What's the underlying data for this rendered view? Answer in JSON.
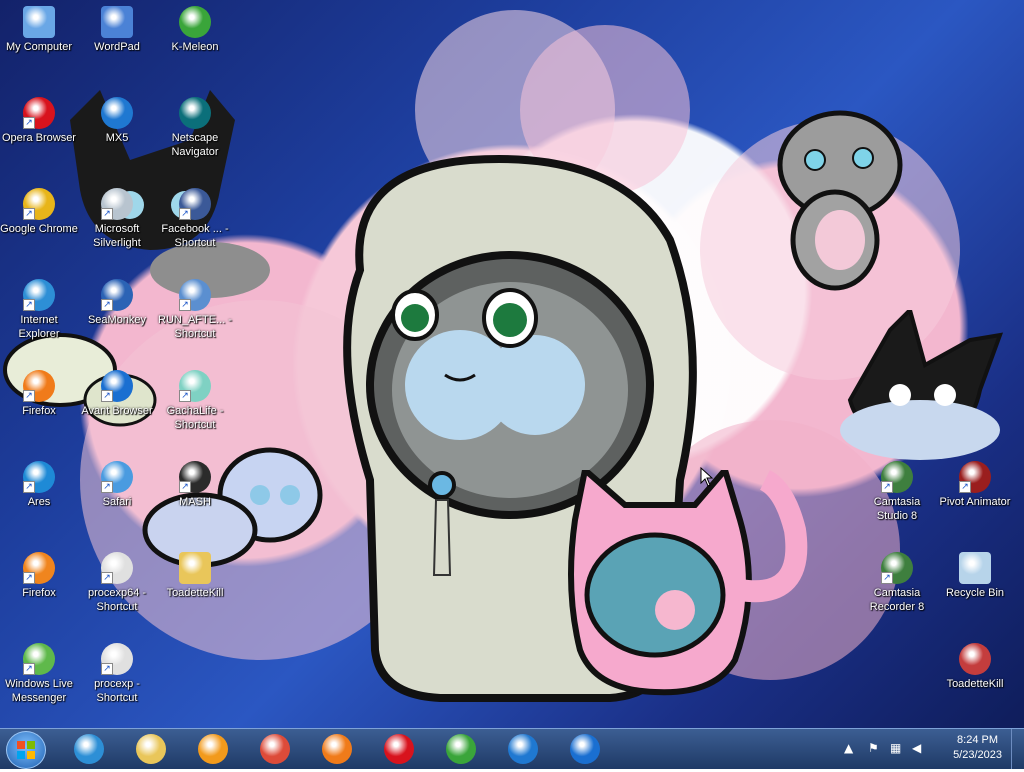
{
  "desktop_icons": [
    {
      "name": "my-computer-icon",
      "label": "My Computer",
      "color": "#6aa7e6",
      "shortcut": false
    },
    {
      "name": "wordpad-icon",
      "label": "WordPad",
      "color": "#4b82d6",
      "shortcut": false
    },
    {
      "name": "k-meleon-icon",
      "label": "K-Meleon",
      "color": "#3aa53a",
      "shortcut": false
    },
    {
      "name": "opera-icon",
      "label": "Opera Browser",
      "color": "#d8131d",
      "shortcut": true
    },
    {
      "name": "mx5-icon",
      "label": "MX5",
      "color": "#1f78d1",
      "shortcut": false
    },
    {
      "name": "netscape-icon",
      "label": "Netscape Navigator",
      "color": "#0b6f7a",
      "shortcut": false
    },
    {
      "name": "chrome-icon",
      "label": "Google Chrome",
      "color": "#e8b51a",
      "shortcut": true
    },
    {
      "name": "silverlight-icon",
      "label": "Microsoft Silverlight",
      "color": "#b8c4cf",
      "shortcut": true
    },
    {
      "name": "facebook-shortcut-icon",
      "label": "Facebook ... - Shortcut",
      "color": "#3b5998",
      "shortcut": true
    },
    {
      "name": "internet-explorer-icon",
      "label": "Internet Explorer",
      "color": "#2d8fd6",
      "shortcut": true
    },
    {
      "name": "seamonkey-icon",
      "label": "SeaMonkey",
      "color": "#2b63b5",
      "shortcut": true
    },
    {
      "name": "run-after-shortcut-icon",
      "label": "RUN_AFTE... - Shortcut",
      "color": "#5b8fd0",
      "shortcut": true
    },
    {
      "name": "firefox-icon",
      "label": "Firefox",
      "color": "#f07b1a",
      "shortcut": true
    },
    {
      "name": "avant-browser-icon",
      "label": "Avant Browser",
      "color": "#1a6fd1",
      "shortcut": true
    },
    {
      "name": "gachalife-shortcut-icon",
      "label": "GachaLife - Shortcut",
      "color": "#7fd1c3",
      "shortcut": true
    },
    {
      "name": "ares-icon",
      "label": "Ares",
      "color": "#1e8ad6",
      "shortcut": true
    },
    {
      "name": "safari-icon",
      "label": "Safari",
      "color": "#4a9be0",
      "shortcut": true
    },
    {
      "name": "mash-icon",
      "label": "MASH",
      "color": "#2b2b2b",
      "shortcut": true
    },
    {
      "name": "firefox-2-icon",
      "label": "Firefox",
      "color": "#f0851e",
      "shortcut": true
    },
    {
      "name": "procexp64-shortcut-icon",
      "label": "procexp64 - Shortcut",
      "color": "#e0e0e0",
      "shortcut": true
    },
    {
      "name": "toadettekill-folder-icon",
      "label": "ToadetteKill",
      "color": "#e9c65a",
      "shortcut": false
    },
    {
      "name": "windows-live-messenger-icon",
      "label": "Windows Live Messenger",
      "color": "#5fb94b",
      "shortcut": true
    },
    {
      "name": "procexp-shortcut-icon",
      "label": "procexp - Shortcut",
      "color": "#e0e0e0",
      "shortcut": true
    },
    {
      "name": "camtasia-studio-icon",
      "label": "Camtasia Studio 8",
      "color": "#3e7f3e",
      "shortcut": true
    },
    {
      "name": "pivot-animator-icon",
      "label": "Pivot Animator",
      "color": "#9a1e1e",
      "shortcut": true
    },
    {
      "name": "camtasia-recorder-icon",
      "label": "Camtasia Recorder 8",
      "color": "#3e7f3e",
      "shortcut": true
    },
    {
      "name": "recycle-bin-icon",
      "label": "Recycle Bin",
      "color": "#b7d4ea",
      "shortcut": false
    },
    {
      "name": "toadettekill-icon",
      "label": "ToadetteKill",
      "color": "#c43d3d",
      "shortcut": false
    }
  ],
  "taskbar": {
    "start_color": "#2a78c9",
    "pinned": [
      {
        "name": "ie-taskbar-icon",
        "color": "#2d8fd6"
      },
      {
        "name": "explorer-taskbar-icon",
        "color": "#e9c65a"
      },
      {
        "name": "media-player-taskbar-icon",
        "color": "#f29a1c"
      },
      {
        "name": "chrome-taskbar-icon",
        "color": "#dd4b39"
      },
      {
        "name": "firefox-taskbar-icon",
        "color": "#f07b1a"
      },
      {
        "name": "opera-taskbar-icon",
        "color": "#d8131d"
      },
      {
        "name": "k-meleon-taskbar-icon",
        "color": "#3aa53a"
      },
      {
        "name": "mx5-taskbar-icon",
        "color": "#1f78d1"
      },
      {
        "name": "avant-taskbar-icon",
        "color": "#1a6fd1"
      }
    ],
    "clock": {
      "time": "8:24 PM",
      "date": "5/23/2023"
    }
  }
}
